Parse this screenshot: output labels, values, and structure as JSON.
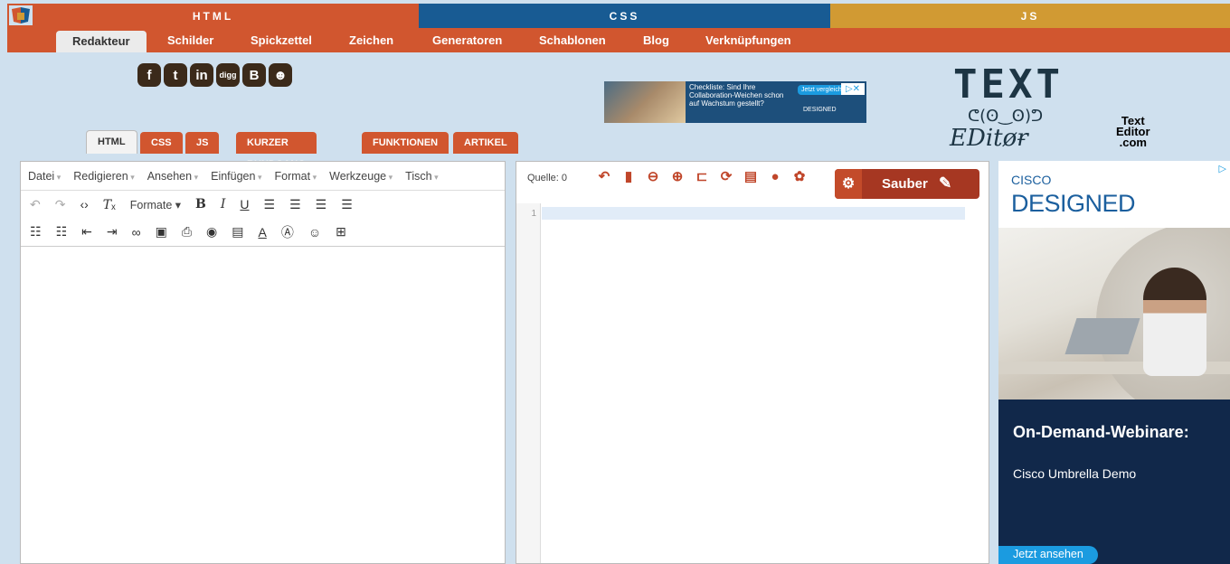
{
  "topbar": {
    "html": "HTML",
    "css": "CSS",
    "js": "JS"
  },
  "colors": {
    "html": "#d1562f",
    "css": "#185b93",
    "js": "#d19a33",
    "accent": "#a63722"
  },
  "menu": [
    "Redakteur",
    "Schilder",
    "Spickzettel",
    "Zeichen",
    "Generatoren",
    "Schablonen",
    "Blog",
    "Verknüpfungen"
  ],
  "social": [
    "facebook-icon",
    "twitter-icon",
    "linkedin-icon",
    "digg-icon",
    "blogger-icon",
    "reddit-icon"
  ],
  "social_labels": {
    "digg": "digg"
  },
  "ad_top": {
    "text": "Checkliste: Sind Ihre Collaboration-Weichen schon auf Wachstum gestellt?",
    "button": "Jetzt vergleichen",
    "brand": "DESIGNED"
  },
  "brand": {
    "big": "TEXT",
    "face": "ᕦ(ʘ‿ʘ)ᕤ",
    "edit": "EDitøɍ",
    "small1": "Text",
    "small2": "Editor",
    "small3": ".com"
  },
  "tabs": [
    "HTML",
    "CSS",
    "JS",
    "KURZER RUNDGANG",
    "FUNKTIONEN",
    "ARTIKEL"
  ],
  "editor_menu": [
    "Datei",
    "Redigieren",
    "Ansehen",
    "Einfügen",
    "Format",
    "Werkzeuge",
    "Tisch"
  ],
  "toolbar": {
    "formats": "Formate"
  },
  "source": {
    "label": "Quelle: 0",
    "line": "1",
    "clean": "Sauber"
  },
  "ad_side": {
    "cisco": "CISCO",
    "designed": "DESIGNED",
    "headline": "On-Demand-Webinare:",
    "sub": "Cisco Umbrella Demo",
    "cta": "Jetzt ansehen"
  }
}
